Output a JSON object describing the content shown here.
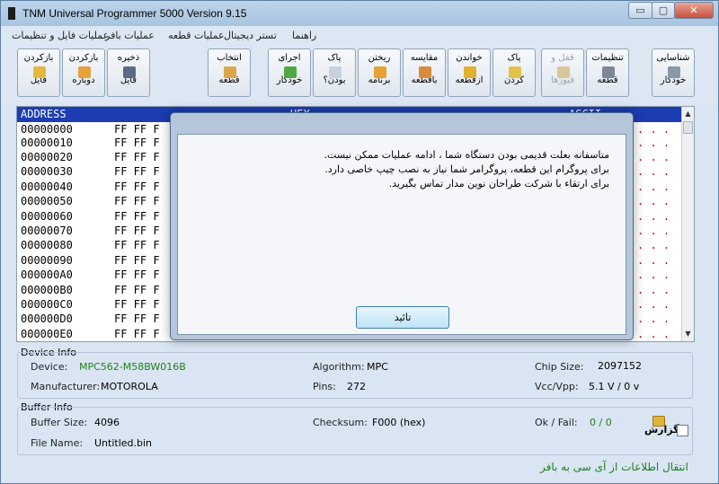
{
  "window": {
    "title": "TNM  Universal Programmer 5000   Version 9.15",
    "min_label": "▭",
    "max_label": "▢",
    "close_label": "✕"
  },
  "menu": {
    "items": [
      "راهنما",
      "تستر دیجیتال",
      "عملیات قطعه",
      "عملیات بافر",
      "عملیات فایل و تنظیمات"
    ]
  },
  "toolbar": {
    "buttons": [
      {
        "line1": "بازکردن",
        "line2": "فایل",
        "icon": "folder-open-icon"
      },
      {
        "line1": "بازکردن",
        "line2": "دوباره",
        "icon": "folder-reload-icon"
      },
      {
        "line1": "ذخیره",
        "line2": "فایل",
        "icon": "save-icon"
      },
      {
        "line1": "انتخاب",
        "line2": "قطعه",
        "icon": "chip-select-icon"
      },
      {
        "line1": "اجرای",
        "line2": "خودکار",
        "icon": "arrow-right-icon"
      },
      {
        "line1": "پاک",
        "line2": "بودن؟",
        "icon": "blank-check-icon"
      },
      {
        "line1": "ریختن",
        "line2": "برنامه",
        "icon": "program-arrow-icon"
      },
      {
        "line1": "مقایسه",
        "line2": "باقطعه",
        "icon": "compare-icon"
      },
      {
        "line1": "خواندن",
        "line2": "ازقطعه",
        "icon": "read-icon"
      },
      {
        "line1": "پاک",
        "line2": "کردن",
        "icon": "erase-icon"
      },
      {
        "line1": "قفل و",
        "line2": "فیوزها",
        "icon": "lock-icon"
      },
      {
        "line1": "تنظیمات",
        "line2": "قطعه",
        "icon": "chip-settings-icon"
      },
      {
        "line1": "شناسایی",
        "line2": "خودکار",
        "icon": "auto-detect-icon"
      }
    ]
  },
  "hex": {
    "header": {
      "address": "ADDRESS",
      "hex": "HEX",
      "ascii": "ASCII"
    },
    "rows": [
      {
        "addr": "00000000",
        "data": "FF FF F"
      },
      {
        "addr": "00000010",
        "data": "FF FF F"
      },
      {
        "addr": "00000020",
        "data": "FF FF F"
      },
      {
        "addr": "00000030",
        "data": "FF FF F"
      },
      {
        "addr": "00000040",
        "data": "FF FF F"
      },
      {
        "addr": "00000050",
        "data": "FF FF F"
      },
      {
        "addr": "00000060",
        "data": "FF FF F"
      },
      {
        "addr": "00000070",
        "data": "FF FF F"
      },
      {
        "addr": "00000080",
        "data": "FF FF F"
      },
      {
        "addr": "00000090",
        "data": "FF FF F"
      },
      {
        "addr": "000000A0",
        "data": "FF FF F"
      },
      {
        "addr": "000000B0",
        "data": "FF FF F"
      },
      {
        "addr": "000000C0",
        "data": "FF FF F"
      },
      {
        "addr": "000000D0",
        "data": "FF FF F"
      },
      {
        "addr": "000000E0",
        "data": "FF FF F"
      }
    ],
    "dots": ". . ."
  },
  "device_info": {
    "title": "Device Info",
    "device_label": "Device:",
    "device": "MPC562-M58BW016B",
    "algorithm_label": "Algorithm:",
    "algorithm": "MPC",
    "chip_size_label": "Chip Size:",
    "chip_size": "2097152",
    "manufacturer_label": "Manufacturer:",
    "manufacturer": "MOTOROLA",
    "pins_label": "Pins:",
    "pins": "272",
    "vcc_label": "Vcc/Vpp:",
    "vcc": "5.1 V / 0 v"
  },
  "buffer_info": {
    "title": "Buffer Info",
    "buffer_size_label": "Buffer Size:",
    "buffer_size": "4096",
    "checksum_label": "Checksum:",
    "checksum": "F000 (hex)",
    "okfail_label": "Ok / Fail:",
    "okfail": "0 / 0",
    "filename_label": "File Name:",
    "filename": "Untitled.bin"
  },
  "report": {
    "label": "گزارش"
  },
  "status": {
    "text": "انتقال اطلاعات از آی سی به بافر"
  },
  "dialog": {
    "lines": [
      "متاسفانه بعلت قدیمی بودن دستگاه شما ، ادامه عملیات ممکن نیست.",
      "برای پروگرام این قطعه، پروگرامر شما نیاز به نصب چیپ خاصی دارد.",
      "برای ارتقاء با شرکت طراحان نوین مدار تماس بگیرید."
    ],
    "ok_label": "تائید"
  },
  "colors": {
    "hex_header_bg": "#1c3cb2",
    "status_green": "#1f7f1f",
    "ascii_dots": "#cc0000"
  }
}
